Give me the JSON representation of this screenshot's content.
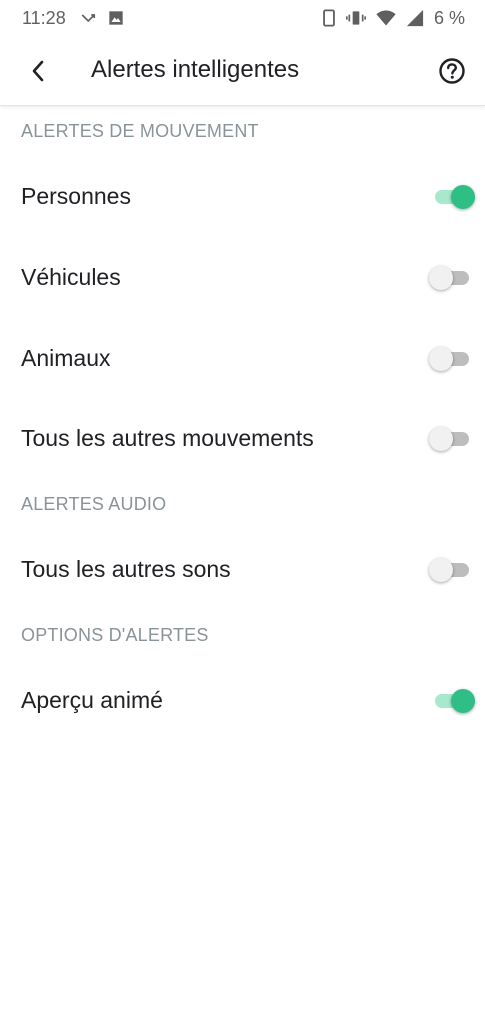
{
  "status_bar": {
    "time": "11:28",
    "battery": "6 %"
  },
  "app_bar": {
    "title": "Alertes intelligentes"
  },
  "colors": {
    "accent": "#2fbf86",
    "accent_track": "#a8e8cc",
    "section_header": "#8a9398"
  },
  "sections": [
    {
      "header": "ALERTES DE MOUVEMENT",
      "items": [
        {
          "label": "Personnes",
          "enabled": true
        },
        {
          "label": "Véhicules",
          "enabled": false
        },
        {
          "label": "Animaux",
          "enabled": false
        },
        {
          "label": "Tous les autres mouvements",
          "enabled": false
        }
      ]
    },
    {
      "header": "ALERTES AUDIO",
      "items": [
        {
          "label": "Tous les autres sons",
          "enabled": false
        }
      ]
    },
    {
      "header": "OPTIONS D'ALERTES",
      "items": [
        {
          "label": "Aperçu animé",
          "enabled": true
        }
      ]
    }
  ]
}
